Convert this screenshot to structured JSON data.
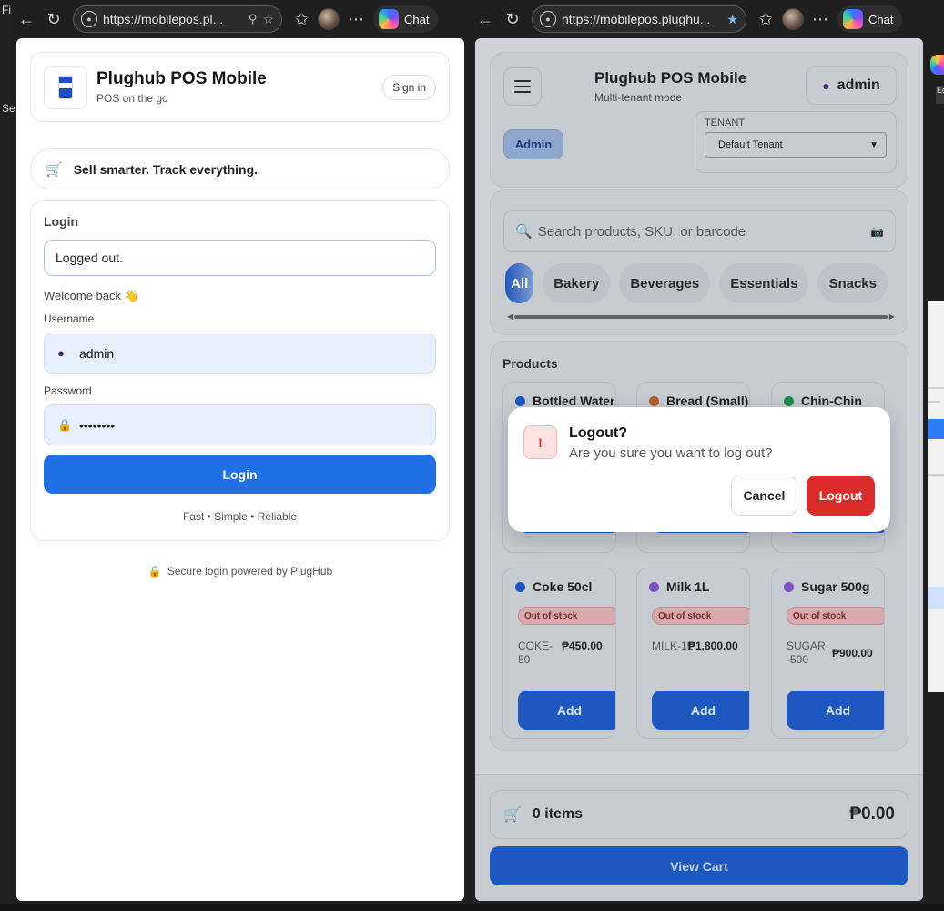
{
  "left_browser": {
    "url": "https://mobilepos.pl...",
    "chat_label": "Chat"
  },
  "right_browser": {
    "url": "https://mobilepos.plughu...",
    "chat_label": "Chat"
  },
  "left_stub": {
    "a": "Fi",
    "b": "Se"
  },
  "login_page": {
    "brand_title": "Plughub POS Mobile",
    "brand_subtitle": "POS on the go",
    "signin_label": "Sign in",
    "tagline": "Sell smarter. Track everything.",
    "login_heading": "Login",
    "status_value": "Logged out.",
    "welcome": "Welcome back 👋",
    "username_label": "Username",
    "username_value": "admin",
    "password_label": "Password",
    "password_value": "••••••••",
    "login_button": "Login",
    "footer_tag": "Fast • Simple • Reliable",
    "secure_text": "Secure login powered by PlugHub"
  },
  "pos_page": {
    "title": "Plughub POS Mobile",
    "subtitle": "Multi-tenant mode",
    "user": "admin",
    "role_badge": "Admin",
    "tenant_label": "TENANT",
    "tenant_value": "Default Tenant",
    "search_placeholder": "Search products, SKU, or barcode",
    "categories": [
      "All",
      "Bakery",
      "Beverages",
      "Essentials",
      "Snacks"
    ],
    "products_heading": "Products",
    "products_row1": [
      {
        "name": "Bottled Water",
        "dot": "#1d58c0"
      },
      {
        "name": "Bread (Small)",
        "dot": "#b35f2c"
      },
      {
        "name": "Chin-Chin",
        "dot": "#1f8a4c"
      }
    ],
    "products_row2": [
      {
        "name": "Coke 50cl",
        "dot": "#1d58c0",
        "stock": "Out of stock",
        "sku": "COKE-50",
        "price": "₱450.00"
      },
      {
        "name": "Milk 1L",
        "dot": "#7a4fc4",
        "stock": "Out of stock",
        "sku": "MILK-1L",
        "price": "₱1,800.00"
      },
      {
        "name": "Sugar 500g",
        "dot": "#7a4fc4",
        "stock": "Out of stock",
        "sku": "SUGAR-500",
        "price": "₱900.00"
      }
    ],
    "add_label": "Add",
    "cart_items": "0 items",
    "cart_total": "₱0.00",
    "view_cart": "View Cart"
  },
  "modal": {
    "icon": "!",
    "title": "Logout?",
    "message": "Are you sure you want to log out?",
    "cancel": "Cancel",
    "confirm": "Logout"
  },
  "right_stub": {
    "ed": "Ed"
  },
  "colors": {
    "primary": "#1f6fe5",
    "danger": "#dc2b2b",
    "overlay_bg": "#ced1d8"
  }
}
